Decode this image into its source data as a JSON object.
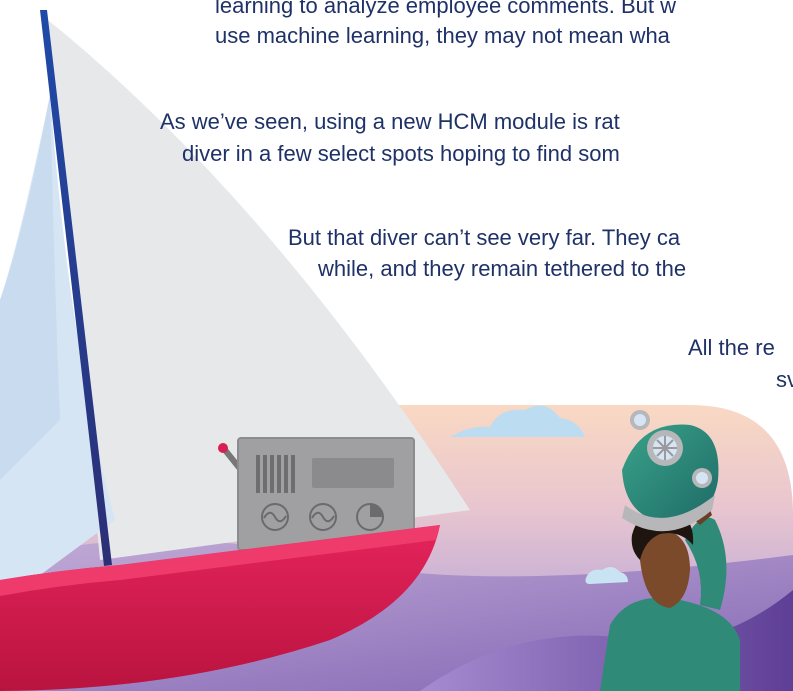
{
  "text": {
    "lines": [
      "learning to analyze employee comments. But w",
      "use machine learning, they may not mean wha",
      "As we’ve seen, using a new HCM module is rat",
      "diver in a few select spots hoping to find som",
      "But that diver can’t see very far. They ca",
      "while, and they remain tethered to the",
      "All the re",
      "sv"
    ]
  },
  "colors": {
    "text": "#1f3268",
    "sky_top": "#f9dcc6",
    "sea_mid": "#b9a6d1",
    "sea_dark": "#6d4c9e",
    "hull": "#d81f55",
    "mast": "#2b3d9b",
    "sail": "#e7e8ea",
    "radio": "#9b9b9d",
    "helmet": "#2f8a78",
    "cloud": "#b9d9ef"
  },
  "icons": {
    "radio_dials": [
      "sine-wave-dial-icon",
      "sine-wave-dial-icon",
      "pie-gauge-dial-icon"
    ],
    "helmet": "diving-helmet-icon"
  }
}
